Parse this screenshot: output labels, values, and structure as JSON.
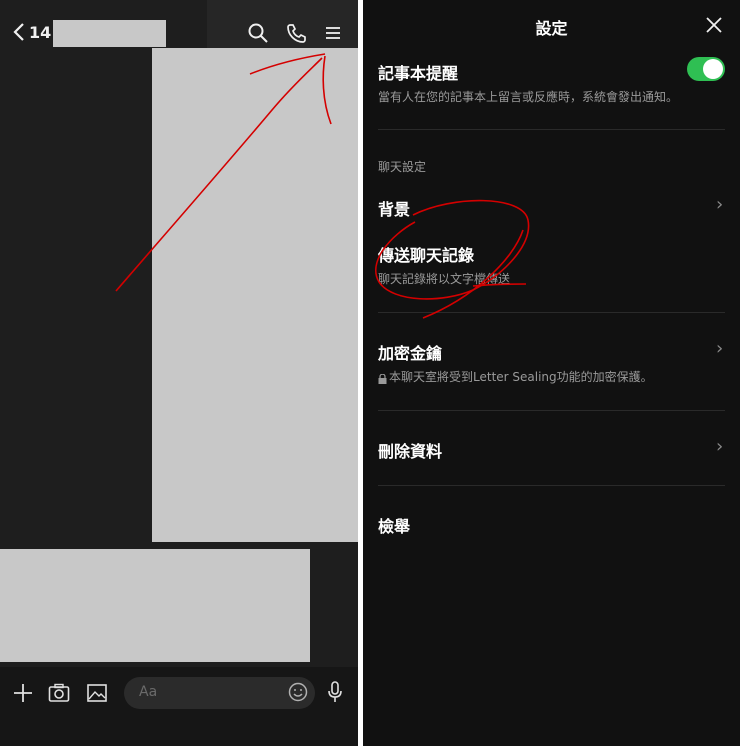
{
  "chat": {
    "back_count": "14",
    "input_placeholder": "Aa"
  },
  "settings": {
    "title": "設定",
    "note_reminder": {
      "title": "記事本提醒",
      "subtitle": "當有人在您的記事本上留言或反應時，系統會發出通知。",
      "enabled": true
    },
    "section_label": "聊天設定",
    "items": [
      {
        "label": "背景"
      },
      {
        "label": "傳送聊天記錄",
        "subtitle": "聊天記錄將以文字檔傳送"
      },
      {
        "label": "加密金鑰",
        "subtitle": "本聊天室將受到Letter Sealing功能的加密保護。"
      },
      {
        "label": "刪除資料"
      },
      {
        "label": "檢舉"
      }
    ]
  },
  "colors": {
    "toggle_on": "#2fbf53",
    "annotation_red": "#d40000"
  }
}
